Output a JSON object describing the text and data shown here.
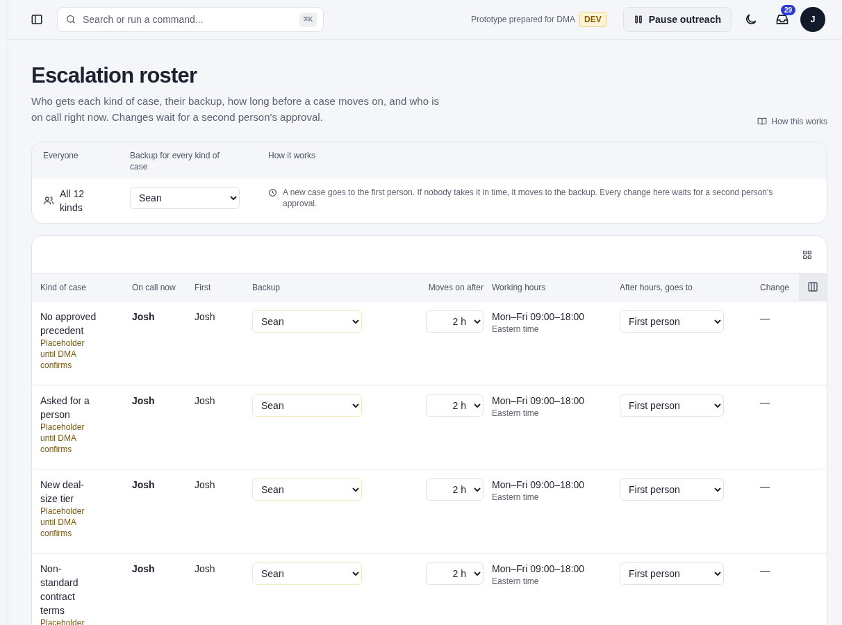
{
  "topbar": {
    "search_placeholder": "Search or run a command...",
    "shortcut": "⌘K",
    "prototype_note": "Prototype prepared for DMA",
    "env_badge": "DEV",
    "pause_button": "Pause outreach",
    "notification_count": "29",
    "avatar_initial": "J"
  },
  "header": {
    "title": "Escalation roster",
    "description": "Who gets each kind of case, their backup, how long before a case moves on, and who is on call right now. Changes wait for a second person's approval.",
    "help_link": "How this works"
  },
  "everyone": {
    "columns": [
      "Everyone",
      "Backup for every kind of case",
      "How it works"
    ],
    "scope": "All 12 kinds",
    "backup": "Sean",
    "explanation": "A new case goes to the first person. If nobody takes it in time, it moves to the backup. Every change here waits for a second person's approval."
  },
  "table": {
    "columns": [
      "Kind of case",
      "On call now",
      "First",
      "Backup",
      "Moves on after",
      "Working hours",
      "After hours, goes to",
      "Change"
    ],
    "rows": [
      {
        "kind": "No approved precedent",
        "note": "Placeholder until DMA confirms",
        "on_call": "Josh",
        "first": "Josh",
        "backup": "Sean",
        "moves_on": "2 h",
        "hours": "Mon–Fri 09:00–18:00",
        "timezone": "Eastern time",
        "after_hours": "First person",
        "change": "—"
      },
      {
        "kind": "Asked for a person",
        "note": "Placeholder until DMA confirms",
        "on_call": "Josh",
        "first": "Josh",
        "backup": "Sean",
        "moves_on": "2 h",
        "hours": "Mon–Fri 09:00–18:00",
        "timezone": "Eastern time",
        "after_hours": "First person",
        "change": "—"
      },
      {
        "kind": "New deal-size tier",
        "note": "Placeholder until DMA confirms",
        "on_call": "Josh",
        "first": "Josh",
        "backup": "Sean",
        "moves_on": "2 h",
        "hours": "Mon–Fri 09:00–18:00",
        "timezone": "Eastern time",
        "after_hours": "First person",
        "change": "—"
      },
      {
        "kind": "Non-standard contract terms",
        "note": "Placeholder",
        "on_call": "Josh",
        "first": "Josh",
        "backup": "Sean",
        "moves_on": "2 h",
        "hours": "Mon–Fri 09:00–18:00",
        "timezone": "Eastern time",
        "after_hours": "First person",
        "change": "—"
      }
    ]
  }
}
